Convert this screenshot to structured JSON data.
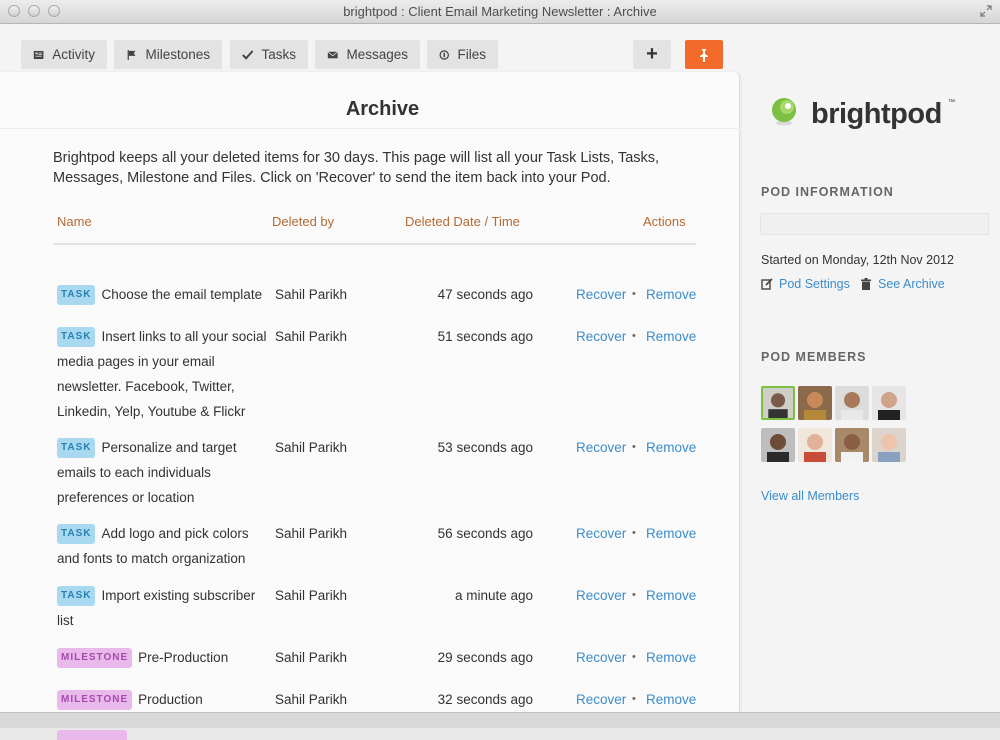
{
  "window": {
    "title": "brightpod : Client Email Marketing Newsletter : Archive"
  },
  "toolbar": {
    "tabs": [
      {
        "label": "Activity",
        "icon": "activity-icon"
      },
      {
        "label": "Milestones",
        "icon": "flag-icon"
      },
      {
        "label": "Tasks",
        "icon": "check-icon"
      },
      {
        "label": "Messages",
        "icon": "envelope-icon"
      },
      {
        "label": "Files",
        "icon": "files-icon"
      }
    ],
    "add_label": "+",
    "accent_color": "#f26b2b"
  },
  "archive": {
    "title": "Archive",
    "intro": "Brightpod keeps all your deleted items for 30 days. This page will list all your Task Lists, Tasks, Messages, Milestone and Files. Click on 'Recover' to send the item back into your Pod.",
    "columns": {
      "name": "Name",
      "deleted_by": "Deleted by",
      "date": "Deleted Date / Time",
      "actions": "Actions"
    },
    "rows": [
      {
        "type": "TASK",
        "name": "Choose the email template",
        "deleted_by": "Sahil Parikh",
        "date": "47 seconds ago",
        "recover": "Recover",
        "sep": "•",
        "remove": "Remove"
      },
      {
        "type": "TASK",
        "name": "Insert links to all your social media pages in your email newsletter. Facebook, Twitter, Linkedin, Yelp, Youtube & Flickr",
        "deleted_by": "Sahil Parikh",
        "date": "51 seconds ago",
        "recover": "Recover",
        "sep": "•",
        "remove": "Remove"
      },
      {
        "type": "TASK",
        "name": "Personalize and target emails to each individuals preferences or location",
        "deleted_by": "Sahil Parikh",
        "date": "53 seconds ago",
        "recover": "Recover",
        "sep": "•",
        "remove": "Remove"
      },
      {
        "type": "TASK",
        "name": "Add logo and pick colors and fonts to match organization",
        "deleted_by": "Sahil Parikh",
        "date": "56 seconds ago",
        "recover": "Recover",
        "sep": "•",
        "remove": "Remove"
      },
      {
        "type": "TASK",
        "name": "Import existing subscriber list",
        "deleted_by": "Sahil Parikh",
        "date": "a minute ago",
        "recover": "Recover",
        "sep": "•",
        "remove": "Remove"
      },
      {
        "type": "MILESTONE",
        "name": "Pre-Production",
        "deleted_by": "Sahil Parikh",
        "date": "29 seconds ago",
        "recover": "Recover",
        "sep": "•",
        "remove": "Remove"
      },
      {
        "type": "MILESTONE",
        "name": "Production",
        "deleted_by": "Sahil Parikh",
        "date": "32 seconds ago",
        "recover": "Recover",
        "sep": "•",
        "remove": "Remove"
      }
    ]
  },
  "sidebar": {
    "logo": "brightpod",
    "logo_tm": "™",
    "pod_info_heading": "POD INFORMATION",
    "started": "Started on Monday, 12th Nov 2012",
    "pod_settings": "Pod Settings",
    "see_archive": "See Archive",
    "pod_members_heading": "POD MEMBERS",
    "view_all": "View all Members"
  },
  "colors": {
    "task_badge": "#a9d9f1",
    "milestone_badge": "#e9b9ec",
    "link": "#3c8cc9",
    "logo_green": "#7bc043"
  }
}
